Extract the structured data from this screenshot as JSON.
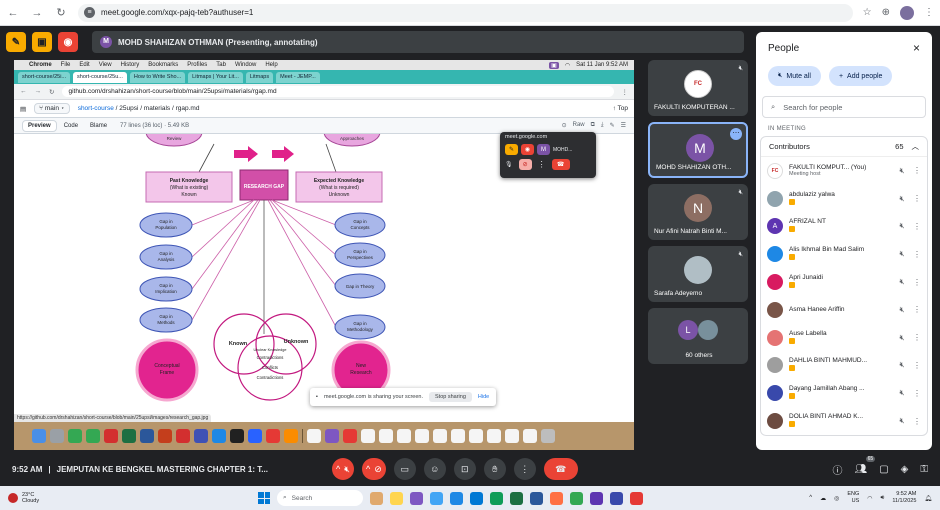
{
  "browser": {
    "url": "meet.google.com/xqx-pajq-teb?authuser=1"
  },
  "meet_top": {
    "presenter_initial": "M",
    "presenting_label": "MOHD SHAHIZAN OTHMAN (Presenting, annotating)"
  },
  "shared_screen": {
    "mac_menu": [
      "Chrome",
      "File",
      "Edit",
      "View",
      "History",
      "Bookmarks",
      "Profiles",
      "Tab",
      "Window",
      "Help"
    ],
    "mac_clock": "Sat 11 Jan  9:52 AM",
    "tabs": [
      "short-course/25i...",
      "short-course/25u...",
      "How to Write Sho...",
      "Litmaps | Your Lit...",
      "Litmaps",
      "Meet - JEMP..."
    ],
    "address": "github.com/drshahizan/short-course/blob/main/25upsi/materials/rgap.md",
    "branch": "main",
    "breadcrumb_repo": "short-course",
    "breadcrumb_path": "/ 25upsi / materials / rgap.md",
    "top_label": "Top",
    "file_tabs": [
      "Preview",
      "Code",
      "Blame"
    ],
    "file_info": "77 lines (36 loc) · 5.49 KB",
    "raw_label": "Raw",
    "status_url": "https://github.com/drshahizan/short-course/blob/main/25upsi/images/research_gap.jpg",
    "meet_popup_title": "meet.google.com",
    "meet_popup_user": "MOHD...",
    "sharing_text": "meet.google.com is sharing your screen.",
    "stop_sharing": "Stop sharing",
    "hide": "Hide"
  },
  "diagram": {
    "top_left": "Review",
    "top_right": "Approaches",
    "past_knowledge": [
      "Past Knowledge",
      "(What is existing)",
      "Known"
    ],
    "research_gap": "RESEARCH GAP",
    "expected_knowledge": [
      "Expected Knowledge",
      "(What is required)",
      "Unknown"
    ],
    "left_gaps": [
      [
        "Gap in",
        "Population"
      ],
      [
        "Gap in",
        "Analysis"
      ],
      [
        "Gap in",
        "Implication"
      ],
      [
        "Gap in",
        "Methods"
      ]
    ],
    "right_gaps": [
      [
        "Gap in",
        "Concepts"
      ],
      [
        "Gap in",
        "Perspectives"
      ],
      [
        "Gap in Theory"
      ],
      [
        "Gap in",
        "Methodology"
      ]
    ],
    "known": "Known",
    "unknown": "Unknown",
    "center_lines": [
      "Unclear Knowledge",
      "Contradictions",
      "Conflicts",
      "Contradictions"
    ],
    "conceptual": [
      "Conceptual",
      "Frame"
    ],
    "new": [
      "New",
      "Research"
    ]
  },
  "tiles": [
    {
      "name": "FAKULTI KOMPUTERAN ...",
      "avatar": "logo",
      "color": "#ffffff"
    },
    {
      "name": "MOHD SHAHIZAN OTH...",
      "avatar": "M",
      "color": "#7b53a6"
    },
    {
      "name": "Nur Afini Natrah Binti M...",
      "avatar": "N",
      "color": "#8d6e63"
    },
    {
      "name": "Sarafa Adeyemo",
      "avatar": "photo",
      "color": "#b0bec5"
    },
    {
      "name": "60 others",
      "avatar": "L",
      "color": "#7b53a6"
    }
  ],
  "people": {
    "title": "People",
    "mute_all": "Mute all",
    "add_people": "Add people",
    "search_placeholder": "Search for people",
    "in_meeting": "IN MEETING",
    "contributors": "Contributors",
    "count": "65",
    "list": [
      {
        "name": "FAKULTI KOMPUT...  (You)",
        "sub": "Meeting host",
        "initial": "FC",
        "color": "#e53935"
      },
      {
        "name": "abdulaziz yalwa",
        "sub": "",
        "initial": "",
        "color": "#90a4ae"
      },
      {
        "name": "AFRIZAL NT",
        "sub": "",
        "initial": "A",
        "color": "#5e35b1"
      },
      {
        "name": "Alis Ikhmal Bin Mad Salim",
        "sub": "",
        "initial": "",
        "color": "#1e88e5"
      },
      {
        "name": "Apri Junaidi",
        "sub": "",
        "initial": "",
        "color": "#d81b60"
      },
      {
        "name": "Asma Hanee Ariffin",
        "sub": "",
        "initial": "",
        "color": "#795548"
      },
      {
        "name": "Ause Labella",
        "sub": "",
        "initial": "",
        "color": "#e57373"
      },
      {
        "name": "DAHLIA BINTI MAHMUD...",
        "sub": "",
        "initial": "",
        "color": "#9e9e9e"
      },
      {
        "name": "Dayang Jamillah Abang ...",
        "sub": "",
        "initial": "",
        "color": "#3949ab"
      },
      {
        "name": "DOLIA BINTI AHMAD K...",
        "sub": "",
        "initial": "",
        "color": "#6d4c41"
      }
    ]
  },
  "bottom": {
    "time": "9:52 AM",
    "meeting_title": "JEMPUTAN KE BENGKEL MASTERING CHAPTER 1: T...",
    "people_badge": "65"
  },
  "taskbar": {
    "temp": "23°C",
    "condition": "Cloudy",
    "search": "Search",
    "lang": "ENG",
    "region": "US",
    "time": "9:52 AM",
    "date": "11/1/2025"
  }
}
